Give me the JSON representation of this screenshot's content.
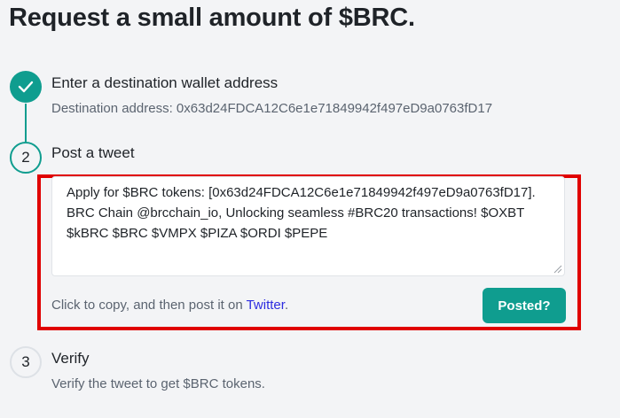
{
  "page": {
    "title": "Request a small amount of $BRC."
  },
  "steps": [
    {
      "number": "1",
      "state": "completed",
      "title": "Enter a destination wallet address",
      "subtitle_label": "Destination address:",
      "subtitle_value": "0x63d24FDCA12C6e1e71849942f497eD9a0763fD17"
    },
    {
      "number": "2",
      "state": "active",
      "title": "Post a tweet",
      "tweet_text": "Apply for $BRC tokens: [0x63d24FDCA12C6e1e71849942f497eD9a0763fD17]. BRC Chain @brcchain_io, Unlocking seamless #BRC20 transactions! $OXBT $kBRC $BRC $VMPX $PIZA $ORDI $PEPE",
      "copy_hint": "Click to copy, and then post it on",
      "copy_link": "Twitter",
      "copy_hint_end": ".",
      "button_label": "Posted?"
    },
    {
      "number": "3",
      "state": "pending",
      "title": "Verify",
      "subtitle": "Verify the tweet to get $BRC tokens."
    }
  ],
  "colors": {
    "accent": "#0f9d8f",
    "highlight": "#e00000",
    "link": "#2d2ce0",
    "background": "#f3f4f6"
  },
  "icons": {
    "step1": "check-icon",
    "resize": "resize-handle-icon"
  }
}
